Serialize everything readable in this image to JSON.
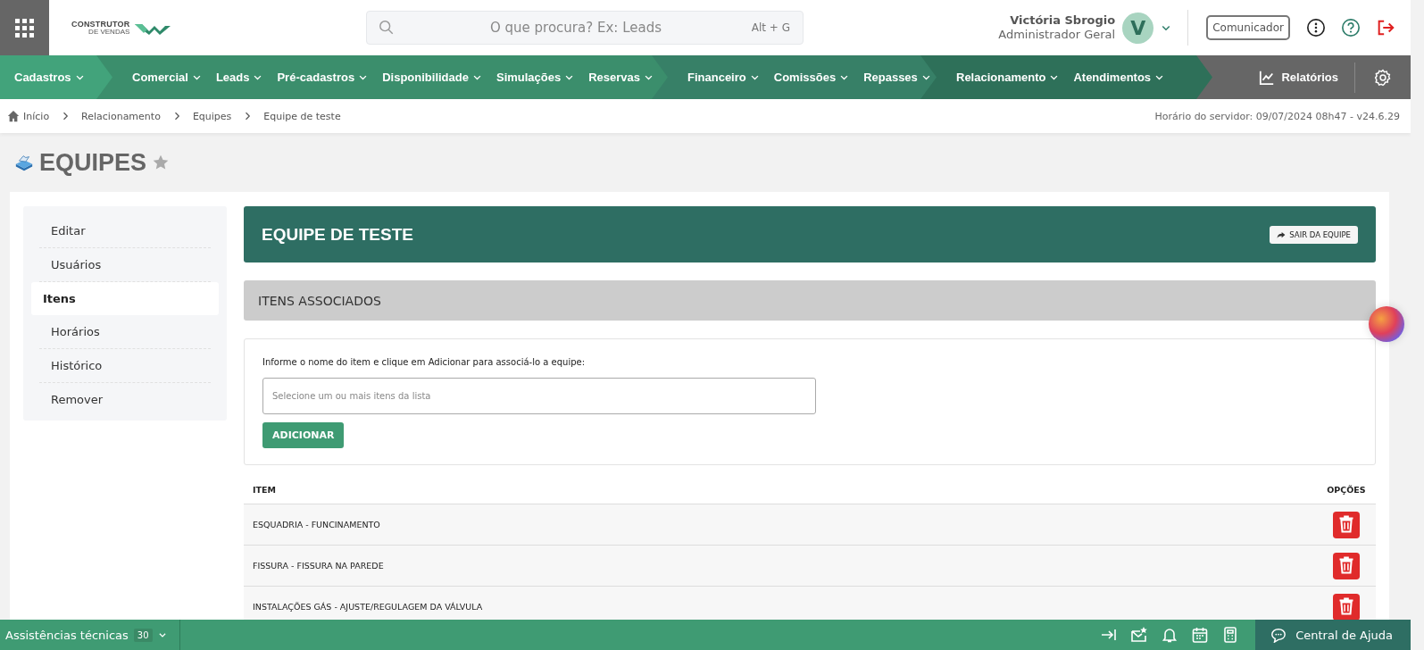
{
  "top_bar": {
    "logo_lines": [
      "CONSTRUTOR",
      "DE VENDAS"
    ],
    "search": {
      "placeholder": "O que procura? Ex: Leads",
      "shortcut": "Alt + G"
    },
    "user": {
      "name": "Victória Sbrogio",
      "role": "Administrador Geral",
      "initial": "V"
    },
    "communicator_button": "Comunicador"
  },
  "nav": {
    "groups": [
      {
        "items": [
          "Cadastros"
        ]
      },
      {
        "items": [
          "Comercial",
          "Leads",
          "Pré-cadastros",
          "Disponibilidade",
          "Simulações",
          "Reservas"
        ]
      },
      {
        "items": [
          "Financeiro",
          "Comissões",
          "Repasses"
        ]
      },
      {
        "items": [
          "Relacionamento",
          "Atendimentos"
        ]
      }
    ],
    "reports": "Relatórios"
  },
  "breadcrumb": {
    "items": [
      "Início",
      "Relacionamento",
      "Equipes",
      "Equipe de teste"
    ],
    "server_info": "Horário do servidor: 09/07/2024 08h47 - v24.6.29"
  },
  "page_title": {
    "text": "EQUIPES",
    "favorite": false
  },
  "sidebar": {
    "items": [
      {
        "label": "Editar",
        "selected": false
      },
      {
        "label": "Usuários",
        "selected": false
      },
      {
        "label": "Itens",
        "selected": true
      },
      {
        "label": "Horários",
        "selected": false
      },
      {
        "label": "Histórico",
        "selected": false
      },
      {
        "label": "Remover",
        "selected": false
      }
    ]
  },
  "team_header": {
    "title": "EQUIPE DE TESTE",
    "leave_button": "SAIR DA EQUIPE"
  },
  "section_title": "ITENS ASSOCIADOS",
  "form": {
    "instruction": "Informe o nome do item e clique em Adicionar para associá-lo a equipe:",
    "placeholder": "Selecione um ou mais itens da lista",
    "add_button": "ADICIONAR"
  },
  "table": {
    "columns": [
      "ITEM",
      "OPÇÕES"
    ],
    "rows": [
      {
        "item": "ESQUADRIA - FUNCINAMENTO"
      },
      {
        "item": "FISSURA - FISSURA NA PAREDE"
      },
      {
        "item": "INSTALAÇÕES GÁS - AJUSTE/REGULAGEM DA VÁLVULA"
      }
    ]
  },
  "bottom_bar": {
    "label": "Assistências técnicas",
    "count": "30",
    "help": "Central de Ajuda"
  }
}
